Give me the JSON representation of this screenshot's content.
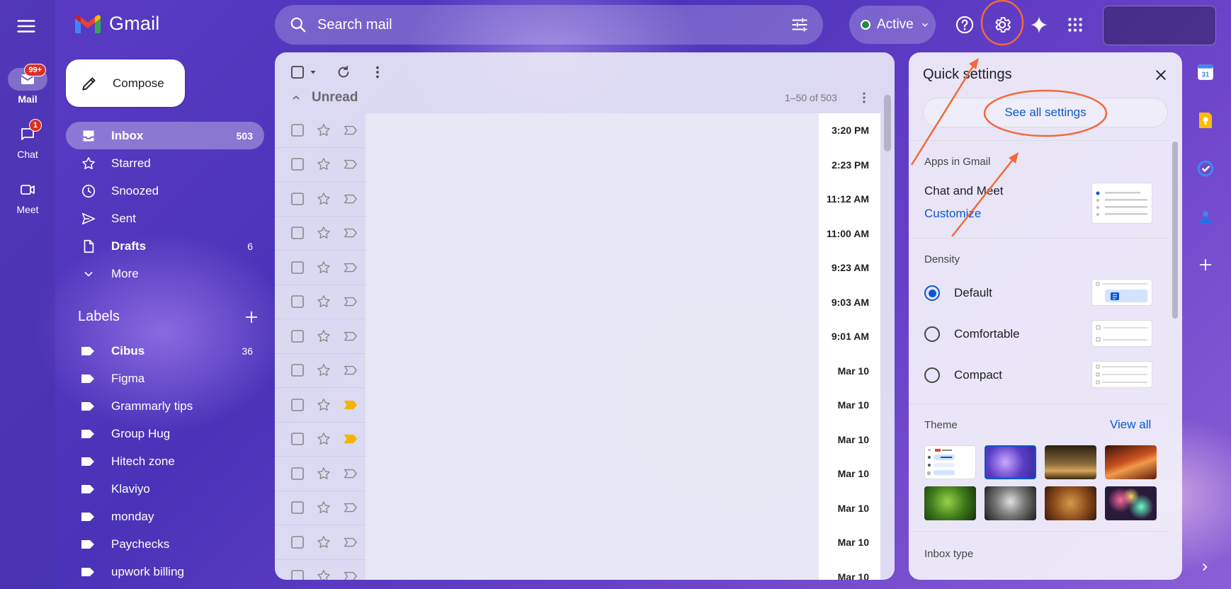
{
  "app": {
    "name": "Gmail"
  },
  "rail": {
    "items": [
      {
        "label": "Mail",
        "badge": "99+"
      },
      {
        "label": "Chat",
        "badge": "1"
      },
      {
        "label": "Meet"
      }
    ]
  },
  "search": {
    "placeholder": "Search mail"
  },
  "status": {
    "label": "Active"
  },
  "compose": {
    "label": "Compose"
  },
  "nav": {
    "items": [
      {
        "label": "Inbox",
        "count": "503"
      },
      {
        "label": "Starred",
        "count": ""
      },
      {
        "label": "Snoozed",
        "count": ""
      },
      {
        "label": "Sent",
        "count": ""
      },
      {
        "label": "Drafts",
        "count": "6"
      },
      {
        "label": "More",
        "count": ""
      }
    ]
  },
  "labels": {
    "title": "Labels",
    "items": [
      {
        "label": "Cibus",
        "count": "36"
      },
      {
        "label": "Figma",
        "count": ""
      },
      {
        "label": "Grammarly tips",
        "count": ""
      },
      {
        "label": "Group Hug",
        "count": ""
      },
      {
        "label": "Hitech zone",
        "count": ""
      },
      {
        "label": "Klaviyo",
        "count": ""
      },
      {
        "label": "monday",
        "count": ""
      },
      {
        "label": "Paychecks",
        "count": ""
      },
      {
        "label": "upwork billing",
        "count": ""
      }
    ]
  },
  "mail_list": {
    "section_title": "Unread",
    "range": "1–50 of 503",
    "rows": [
      {
        "date": "3:20 PM",
        "important": false
      },
      {
        "date": "2:23 PM",
        "important": false
      },
      {
        "date": "11:12 AM",
        "important": false
      },
      {
        "date": "11:00 AM",
        "important": false
      },
      {
        "date": "9:23 AM",
        "important": false
      },
      {
        "date": "9:03 AM",
        "important": false
      },
      {
        "date": "9:01 AM",
        "important": false
      },
      {
        "date": "Mar 10",
        "important": false
      },
      {
        "date": "Mar 10",
        "important": true
      },
      {
        "date": "Mar 10",
        "important": true
      },
      {
        "date": "Mar 10",
        "important": false
      },
      {
        "date": "Mar 10",
        "important": false
      },
      {
        "date": "Mar 10",
        "important": false
      },
      {
        "date": "Mar 10",
        "important": false
      }
    ]
  },
  "quick_settings": {
    "title": "Quick settings",
    "see_all": "See all settings",
    "apps_title": "Apps in Gmail",
    "chat_meet": "Chat and Meet",
    "customize": "Customize",
    "density_title": "Density",
    "density_options": [
      "Default",
      "Comfortable",
      "Compact"
    ],
    "density_selected": "Default",
    "theme_title": "Theme",
    "view_all": "View all",
    "inbox_type_title": "Inbox type"
  },
  "colors": {
    "accent": "#0b57d0",
    "badge": "#d93025",
    "annotation": "#f2693a",
    "important": "#f4b400"
  },
  "side_panel": {
    "calendar_day": "31"
  }
}
